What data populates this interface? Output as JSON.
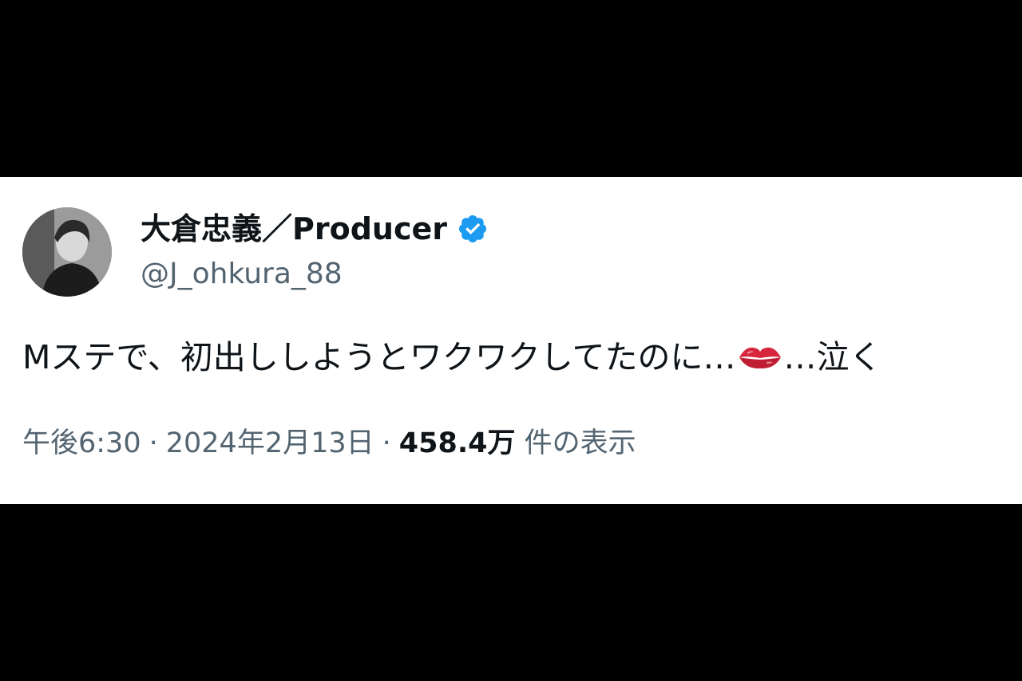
{
  "tweet": {
    "display_name": "大倉忠義／Producer",
    "handle": "@J_ohkura_88",
    "verified": true,
    "text_before_emoji": "Mステで、初出ししようとワクワクしてたのに…",
    "emoji": "kiss-mark-icon",
    "text_after_emoji": "…泣く",
    "time": "午後6:30",
    "separator": "·",
    "date": "2024年2月13日",
    "views_count": "458.4万",
    "views_label": "件の表示"
  },
  "colors": {
    "text_primary": "#0f1419",
    "text_secondary": "#536471",
    "verified_badge": "#1d9bf0",
    "emoji_red": "#d7263d",
    "background_outer": "#000000",
    "card_background": "#ffffff"
  }
}
